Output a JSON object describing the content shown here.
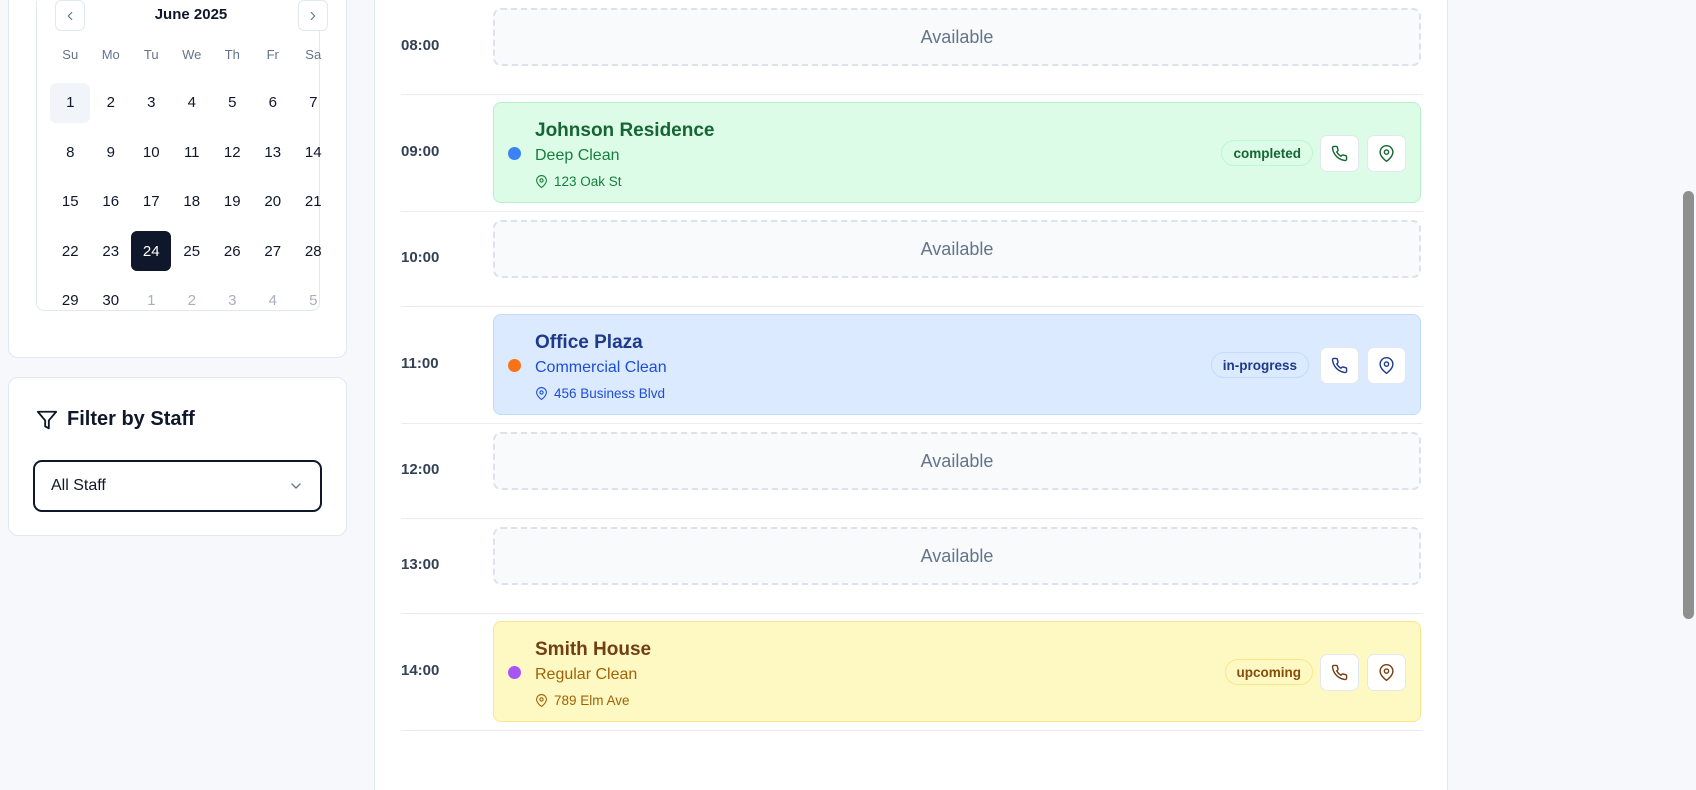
{
  "calendar": {
    "month_label": "June 2025",
    "weekdays": [
      "Su",
      "Mo",
      "Tu",
      "We",
      "Th",
      "Fr",
      "Sa"
    ],
    "weeks": [
      [
        "1",
        "2",
        "3",
        "4",
        "5",
        "6",
        "7"
      ],
      [
        "8",
        "9",
        "10",
        "11",
        "12",
        "13",
        "14"
      ],
      [
        "15",
        "16",
        "17",
        "18",
        "19",
        "20",
        "21"
      ],
      [
        "22",
        "23",
        "24",
        "25",
        "26",
        "27",
        "28"
      ],
      [
        "29",
        "30",
        "1",
        "2",
        "3",
        "4",
        "5"
      ]
    ],
    "selected_day": "24",
    "highlighted_day": "1"
  },
  "filter": {
    "title": "Filter by Staff",
    "selected_value": "All Staff"
  },
  "schedule": {
    "available_label": "Available",
    "slots": [
      {
        "time": "08:00"
      },
      {
        "time": "09:00",
        "client": "Johnson Residence",
        "service": "Deep Clean",
        "address": "123 Oak St",
        "status": "completed",
        "dot_color": "#3b82f6"
      },
      {
        "time": "10:00"
      },
      {
        "time": "11:00",
        "client": "Office Plaza",
        "service": "Commercial Clean",
        "address": "456 Business Blvd",
        "status": "in-progress",
        "dot_color": "#f97316"
      },
      {
        "time": "12:00"
      },
      {
        "time": "13:00"
      },
      {
        "time": "14:00",
        "client": "Smith House",
        "service": "Regular Clean",
        "address": "789 Elm Ave",
        "status": "upcoming",
        "dot_color": "#a855f7"
      }
    ]
  },
  "theme": {
    "completed": "#dcfce7",
    "in_progress": "#dbeafe",
    "upcoming": "#fef9c3",
    "selected_day_bg": "#0f172a"
  }
}
